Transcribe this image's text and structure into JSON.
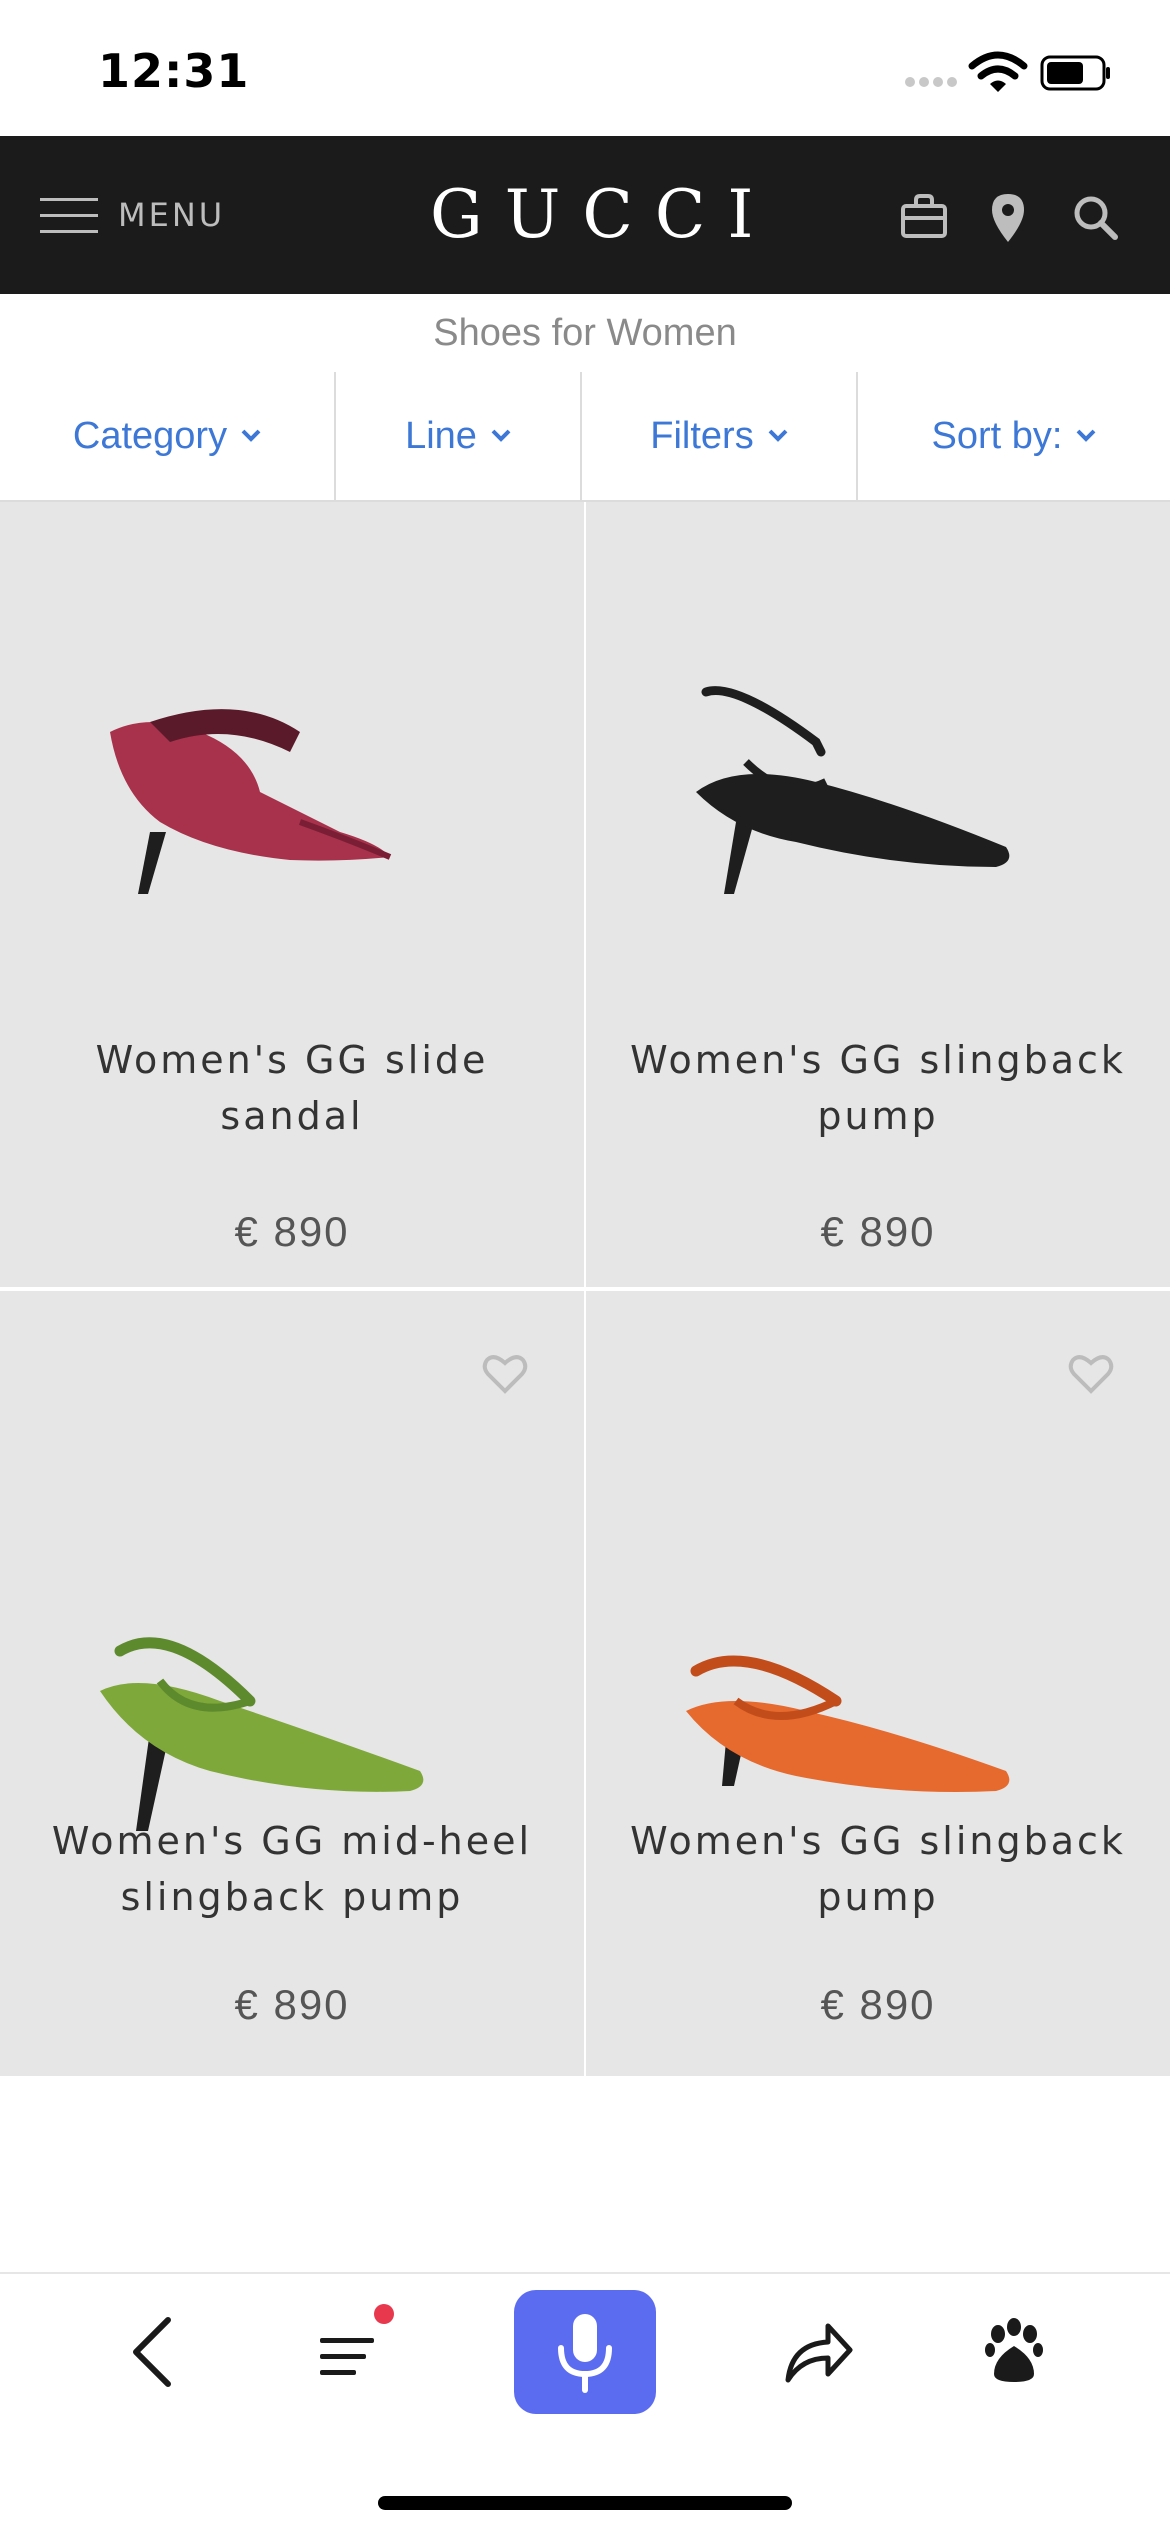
{
  "status": {
    "time": "12:31"
  },
  "header": {
    "menu_label": "MENU",
    "logo": "GUCCI"
  },
  "page": {
    "subtitle": "Shoes for Women"
  },
  "filters": [
    {
      "label": "Category"
    },
    {
      "label": "Line"
    },
    {
      "label": "Filters"
    },
    {
      "label": "Sort by:"
    }
  ],
  "products": [
    {
      "title_line1": "Women's GG slide",
      "title_line2": "sandal",
      "price": "€ 890",
      "color": "#a8324c"
    },
    {
      "title_line1": "Women's GG slingback",
      "title_line2": "pump",
      "price": "€ 890",
      "color": "#1e1e1e"
    },
    {
      "title_line1": "Women's GG mid-heel",
      "title_line2": "slingback pump",
      "price": "€ 890",
      "color": "#7ea83a"
    },
    {
      "title_line1": "Women's GG slingback",
      "title_line2": "pump",
      "price": "€ 890",
      "color": "#e6692e"
    }
  ],
  "colors": {
    "accent": "#3d78d6",
    "header_bg": "#1b1b1b",
    "card_bg": "#e6e6e6",
    "mic_bg": "#5b6cf0"
  }
}
